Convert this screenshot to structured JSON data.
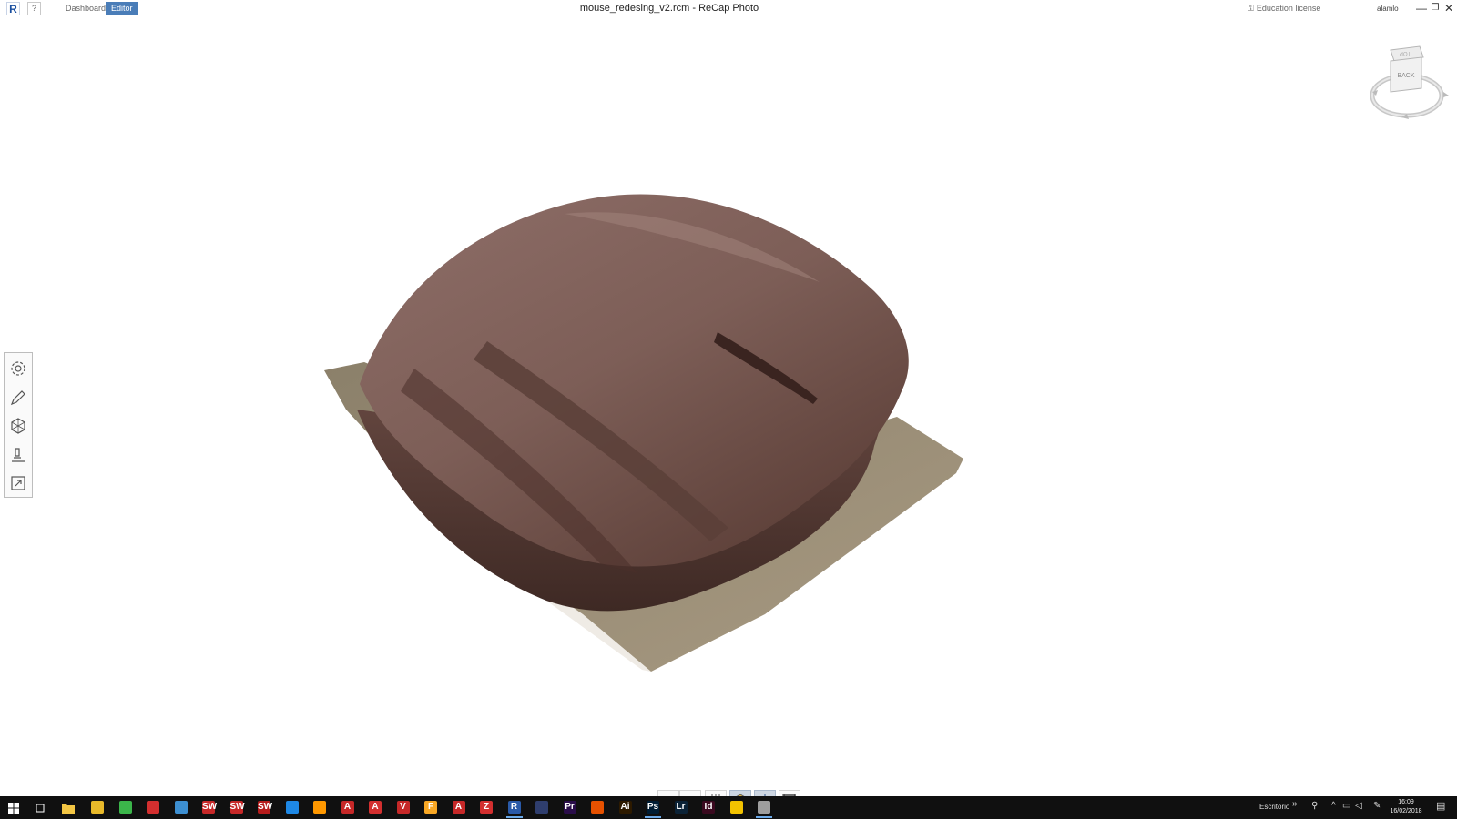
{
  "titlebar": {
    "logo": "R",
    "help": "?",
    "tabs": {
      "dashboard": "Dashboard",
      "editor": "Editor"
    },
    "title": "mouse_redesing_v2.rcm - ReCap Photo",
    "license": "Education license",
    "user": "alamlo",
    "controls": {
      "minimize": "—",
      "maximize": "❐",
      "close": "✕"
    }
  },
  "viewcube": {
    "face": "BACK",
    "top": "TOP"
  },
  "left_tools": [
    "settings-icon",
    "pencil-icon",
    "mesh-icon",
    "measure-icon",
    "export-icon"
  ],
  "bottom_toolbar": [
    "undo-icon",
    "redo-icon",
    "adjust-icon",
    "shaded-view-icon",
    "orbit-icon",
    "fit-view-icon"
  ],
  "taskbar": {
    "apps": [
      {
        "name": "chrome-icon",
        "color": "#e8b92a",
        "label": ""
      },
      {
        "name": "app-green-icon",
        "color": "#3bb54a",
        "label": ""
      },
      {
        "name": "app-red-star-icon",
        "color": "#d32f2f",
        "label": ""
      },
      {
        "name": "app-blue-cube-icon",
        "color": "#3d8fd1",
        "label": ""
      },
      {
        "name": "solidworks-icon",
        "color": "#c62828",
        "label": "SW"
      },
      {
        "name": "solidworks2-icon",
        "color": "#c62828",
        "label": "SW"
      },
      {
        "name": "solidworks3-icon",
        "color": "#b71c1c",
        "label": "SW"
      },
      {
        "name": "app-blue-circle-icon",
        "color": "#1e88e5",
        "label": ""
      },
      {
        "name": "app-fox-icon",
        "color": "#ff9800",
        "label": ""
      },
      {
        "name": "autocad-icon",
        "color": "#c62828",
        "label": "A"
      },
      {
        "name": "acrobat-icon",
        "color": "#d32f2f",
        "label": "A"
      },
      {
        "name": "vectorworks-icon",
        "color": "#c62828",
        "label": "V"
      },
      {
        "name": "app-f-icon",
        "color": "#f9a825",
        "label": "F"
      },
      {
        "name": "autocad2-icon",
        "color": "#c62828",
        "label": "A"
      },
      {
        "name": "app-z-icon",
        "color": "#d32f2f",
        "label": "Z"
      },
      {
        "name": "recap-icon",
        "color": "#2a5aa8",
        "label": "R"
      },
      {
        "name": "cinema4d-icon",
        "color": "#2f3e6e",
        "label": ""
      },
      {
        "name": "premiere-icon",
        "color": "#2a0d4a",
        "label": "Pr"
      },
      {
        "name": "app-pen-icon",
        "color": "#e65100",
        "label": ""
      },
      {
        "name": "illustrator-icon",
        "color": "#2d1a00",
        "label": "Ai"
      },
      {
        "name": "photoshop-icon",
        "color": "#001d34",
        "label": "Ps"
      },
      {
        "name": "lightroom-icon",
        "color": "#0b2236",
        "label": "Lr"
      },
      {
        "name": "indesign-icon",
        "color": "#3a0a1f",
        "label": "Id"
      },
      {
        "name": "app-yellow-icon",
        "color": "#f2c200",
        "label": ""
      },
      {
        "name": "app-window-icon",
        "color": "#9e9e9e",
        "label": ""
      }
    ],
    "desktop_label": "Escritorio",
    "overflow": "»",
    "time": "16:09",
    "date": "16/02/2018"
  }
}
